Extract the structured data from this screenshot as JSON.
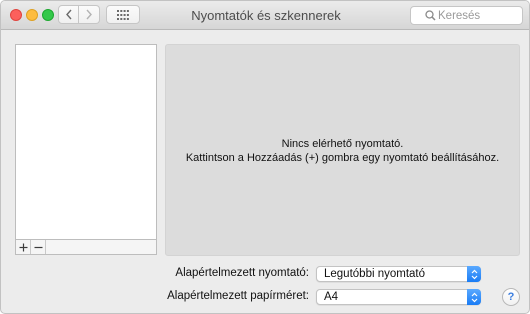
{
  "window": {
    "title": "Nyomtatók és szkennerek"
  },
  "toolbar": {
    "back_icon": "chevron-left-icon",
    "forward_icon": "chevron-right-icon",
    "show_all_icon": "grid-icon"
  },
  "search": {
    "placeholder": "Keresés",
    "value": ""
  },
  "printer_list": {
    "items": [],
    "add_icon": "plus-icon",
    "remove_icon": "minus-icon"
  },
  "detail": {
    "empty_title": "Nincs elérhető nyomtató.",
    "empty_hint": "Kattintson a Hozzáadás (+) gombra egy nyomtató beállításához."
  },
  "settings": {
    "default_printer_label": "Alapértelmezett nyomtató:",
    "default_printer_value": "Legutóbbi nyomtató",
    "paper_size_label": "Alapértelmezett papírméret:",
    "paper_size_value": "A4"
  },
  "help": {
    "label": "?"
  },
  "colors": {
    "accent": "#1a7cf5",
    "close": "#fc605c",
    "minimize": "#fdbc40",
    "zoom": "#34c84a"
  }
}
